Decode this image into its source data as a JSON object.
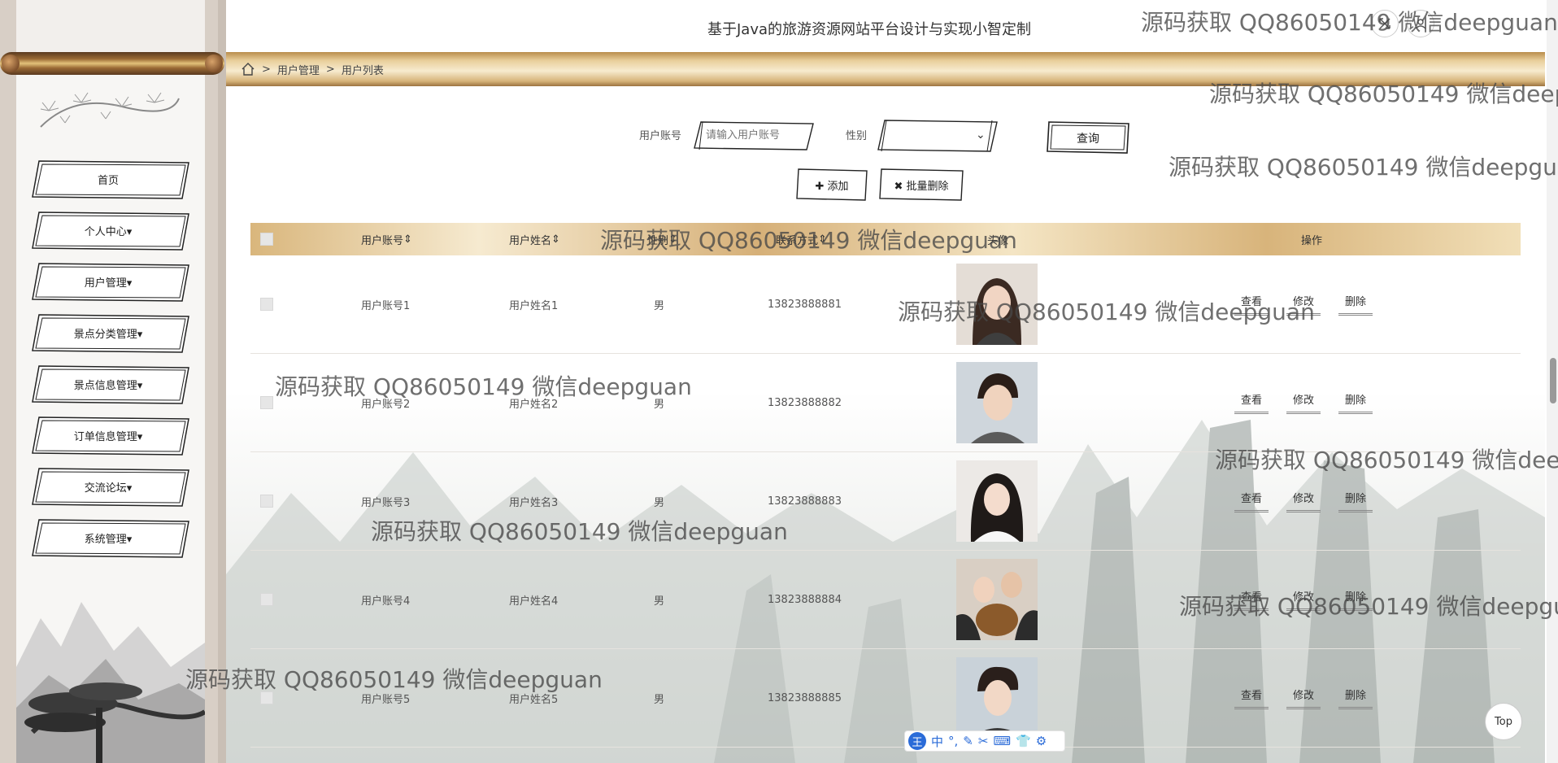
{
  "header": {
    "title": "基于Java的旅游资源网站平台设计与实现小智定制",
    "fullscreen_icon": "expand-icon",
    "user_icon": "user-icon"
  },
  "breadcrumb": {
    "home_icon": "home-icon",
    "sep": ">",
    "items": [
      "用户管理",
      "用户列表"
    ]
  },
  "sidebar": {
    "items": [
      {
        "label": "首页"
      },
      {
        "label": "个人中心"
      },
      {
        "label": "用户管理"
      },
      {
        "label": "景点分类管理"
      },
      {
        "label": "景点信息管理"
      },
      {
        "label": "订单信息管理"
      },
      {
        "label": "交流论坛"
      },
      {
        "label": "系统管理"
      }
    ],
    "caret": "▾"
  },
  "search": {
    "account_label": "用户账号",
    "account_placeholder": "请输入用户账号",
    "gender_label": "性别",
    "gender_value": "",
    "query_button": "查询",
    "add_button": "添加",
    "batch_delete_button": "批量删除"
  },
  "table": {
    "columns": [
      "用户账号",
      "用户姓名",
      "性别",
      "联系方式",
      "头像",
      "操作"
    ],
    "sort_icon": "⇕",
    "rows": [
      {
        "account": "用户账号1",
        "name": "用户姓名1",
        "gender": "男",
        "phone": "13823888881"
      },
      {
        "account": "用户账号2",
        "name": "用户姓名2",
        "gender": "男",
        "phone": "13823888882"
      },
      {
        "account": "用户账号3",
        "name": "用户姓名3",
        "gender": "男",
        "phone": "13823888883"
      },
      {
        "account": "用户账号4",
        "name": "用户姓名4",
        "gender": "男",
        "phone": "13823888884"
      },
      {
        "account": "用户账号5",
        "name": "用户姓名5",
        "gender": "男",
        "phone": "13823888885"
      }
    ],
    "actions": {
      "view": "查看",
      "edit": "修改",
      "delete": "删除"
    }
  },
  "watermark": "源码获取 QQ86050149 微信deepguan",
  "top_button": "Top",
  "ime": {
    "logo": "王",
    "items": [
      "中",
      "°,",
      "✎",
      "✂",
      "⌨",
      "👕",
      "⚙"
    ]
  },
  "colors": {
    "gold": "#d8b47b",
    "accent": "#2a6bd8"
  }
}
